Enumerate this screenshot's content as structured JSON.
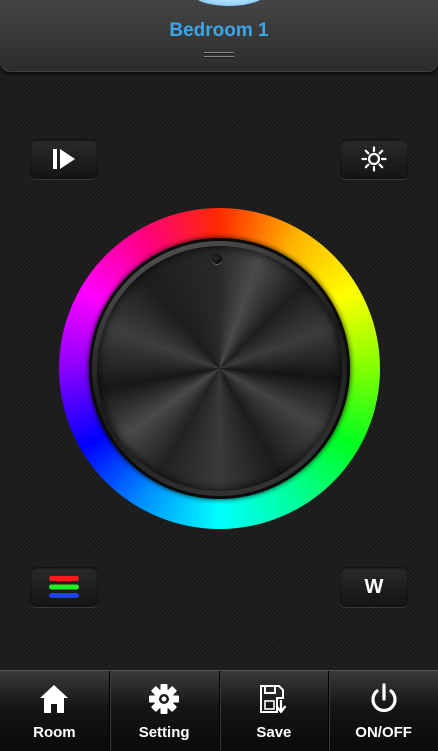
{
  "header": {
    "room_title": "Bedroom 1"
  },
  "controls": {
    "play_icon": "play-step-icon",
    "brightness_icon": "sun-icon",
    "rgb_icon": "rgb-bars-icon",
    "white_label": "W"
  },
  "color_wheel": {
    "type": "hue-ring",
    "knob_icon": "knob-indicator-dot"
  },
  "tabbar": {
    "tabs": [
      {
        "label": "Room",
        "icon": "home-icon"
      },
      {
        "label": "Setting",
        "icon": "gear-icon"
      },
      {
        "label": "Save",
        "icon": "save-icon"
      },
      {
        "label": "ON/OFF",
        "icon": "power-icon"
      }
    ]
  },
  "colors": {
    "accent": "#3aa6ea",
    "background": "#1e1e1e"
  }
}
